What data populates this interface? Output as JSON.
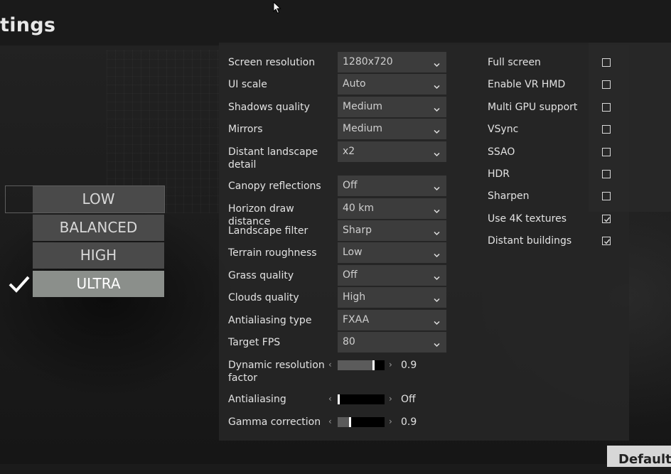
{
  "header": {
    "title": "tings"
  },
  "presets": [
    {
      "label": "LOW",
      "selected": false
    },
    {
      "label": "BALANCED",
      "selected": false
    },
    {
      "label": "HIGH",
      "selected": false
    },
    {
      "label": "ULTRA",
      "selected": true
    }
  ],
  "settings": [
    {
      "label": "Screen resolution",
      "value": "1280x720"
    },
    {
      "label": "UI scale",
      "value": "Auto"
    },
    {
      "label": "Shadows quality",
      "value": "Medium"
    },
    {
      "label": "Mirrors",
      "value": "Medium"
    },
    {
      "label": "Distant landscape detail",
      "value": "x2"
    },
    {
      "label": "Canopy reflections",
      "value": "Off"
    },
    {
      "label": "Horizon draw distance",
      "value": "40 km"
    },
    {
      "label": "Landscape filter",
      "value": "Sharp"
    },
    {
      "label": "Terrain roughness",
      "value": "Low"
    },
    {
      "label": "Grass quality",
      "value": "Off"
    },
    {
      "label": "Clouds quality",
      "value": "High"
    },
    {
      "label": "Antialiasing type",
      "value": "FXAA"
    },
    {
      "label": "Target FPS",
      "value": "80"
    }
  ],
  "sliders": [
    {
      "label": "Dynamic resolution factor",
      "display": "0.9",
      "level": 0.78
    },
    {
      "label": "Antialiasing",
      "display": "Off",
      "level": 0.0
    },
    {
      "label": "Gamma correction",
      "display": "0.9",
      "level": 0.25
    }
  ],
  "options": [
    {
      "label": "Full screen",
      "checked": false
    },
    {
      "label": "Enable VR HMD",
      "checked": false
    },
    {
      "label": "Multi GPU support",
      "checked": false
    },
    {
      "label": "VSync",
      "checked": false
    },
    {
      "label": "SSAO",
      "checked": false
    },
    {
      "label": "HDR",
      "checked": false
    },
    {
      "label": "Sharpen",
      "checked": false
    },
    {
      "label": "Use 4K textures",
      "checked": true
    },
    {
      "label": "Distant buildings",
      "checked": true
    }
  ],
  "footer": {
    "default_label": "Default"
  },
  "icons": {
    "cursor": "mouse-cursor-icon",
    "selected": "checkmark-icon",
    "dropdown": "chevron-down-icon",
    "slider_left": "chevron-left-icon",
    "slider_right": "chevron-right-icon"
  }
}
